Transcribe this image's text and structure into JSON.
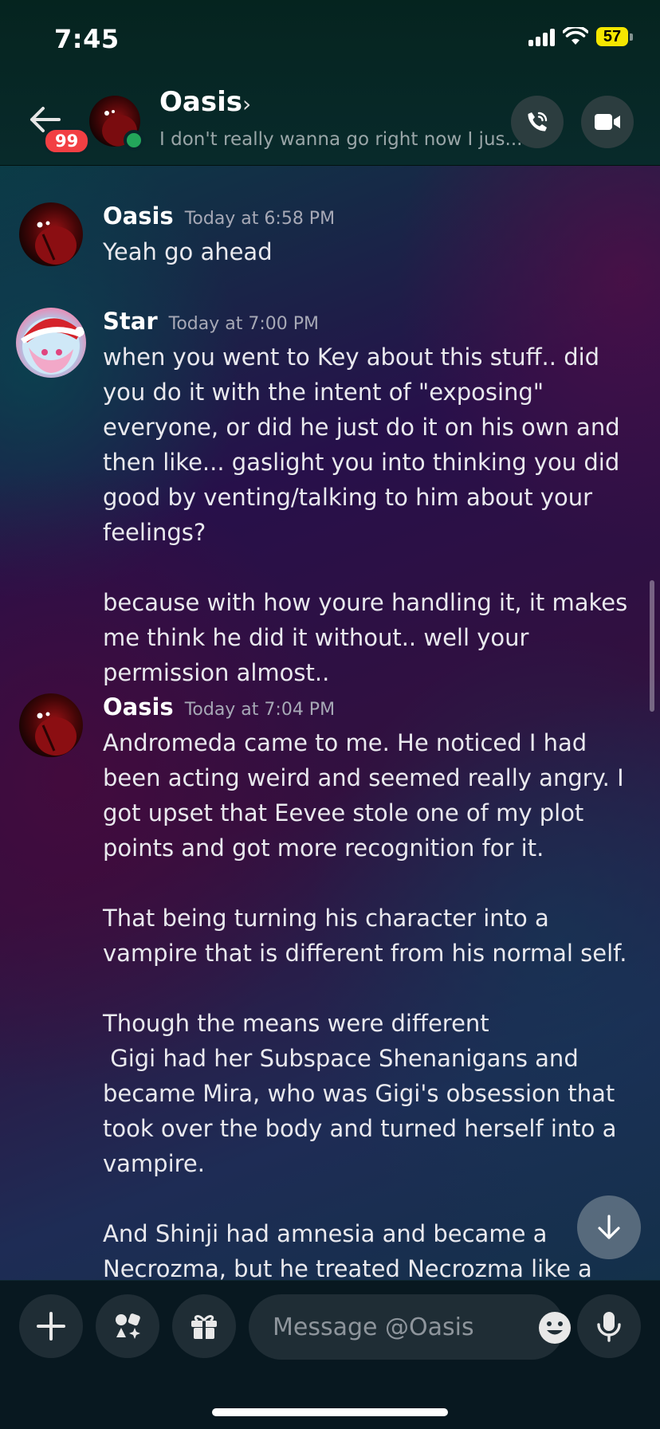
{
  "status": {
    "time": "7:45",
    "battery": "57"
  },
  "header": {
    "unread_badge": "99",
    "name": "Oasis",
    "chevron": "›",
    "subtitle": "I don't really wanna go right now I jus..."
  },
  "messages": [
    {
      "author": "Oasis",
      "timestamp": "Today at 6:58 PM",
      "text": "Yeah go ahead"
    },
    {
      "author": "Star",
      "timestamp": "Today at 7:00 PM",
      "text": "when you went to Key about this stuff.. did you do it with the intent of \"exposing\" everyone, or did he just do it on his own and then like... gaslight you into thinking you did good by venting/talking to him about your feelings?\n\nbecause with how youre handling it, it makes me think he did it without.. well your permission almost.."
    },
    {
      "author": "Oasis",
      "timestamp": "Today at 7:04 PM",
      "text": "Andromeda came to me. He noticed I had been acting weird and seemed really angry. I got upset that Eevee stole one of my plot points and got more recognition for it.\n\nThat being turning his character into a vampire that is different from his normal self.\n\nThough the means were different\n Gigi had her Subspace Shenanigans and became Mira, who was Gigi's obsession that took over the body and turned herself into a vampire.\n\nAnd Shinji had amnesia and became a Necrozma, but he treated Necrozma like a"
    }
  ],
  "composer": {
    "placeholder": "Message @Oasis"
  },
  "icons": [
    "back-arrow-icon",
    "phone-icon",
    "video-camera-icon",
    "plus-icon",
    "apps-icon",
    "gift-icon",
    "emoji-icon",
    "microphone-icon",
    "arrow-down-icon"
  ]
}
